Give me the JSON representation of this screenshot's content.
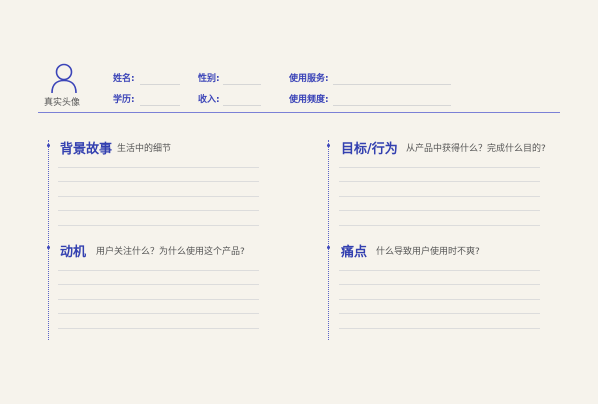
{
  "avatar": {
    "caption": "真实头像"
  },
  "profile": {
    "name_label": "姓名:",
    "gender_label": "性别:",
    "service_label": "使用服务:",
    "education_label": "学历:",
    "income_label": "收入:",
    "frequency_label": "使用频度:"
  },
  "sections": {
    "background": {
      "title": "背景故事",
      "subtitle": "生活中的细节"
    },
    "goals": {
      "title": "目标/行为",
      "subtitle": "从产品中获得什么？完成什么目的?"
    },
    "motivation": {
      "title": "动机",
      "subtitle": "用户关注什么？为什么使用这个产品?"
    },
    "pain_points": {
      "title": "痛点",
      "subtitle": "什么导致用户使用时不爽?"
    }
  },
  "colors": {
    "accent": "#3b44b8",
    "background": "#f6f3ec"
  }
}
